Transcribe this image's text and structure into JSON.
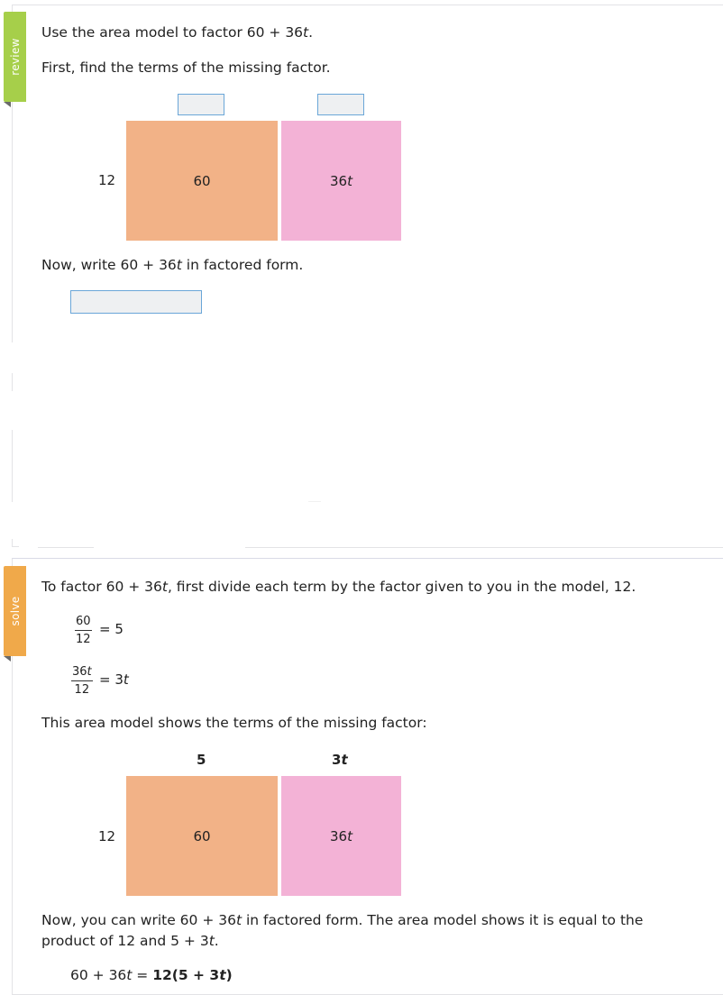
{
  "review": {
    "tab_label": "review",
    "prompt_prefix": "Use the area model to factor 60 + 36",
    "prompt_var": "t",
    "prompt_suffix": ".",
    "instruction": "First, find the terms of the missing factor.",
    "model": {
      "row_label": "12",
      "cell1": "60",
      "cell2_num": "36",
      "cell2_var": "t"
    },
    "write_prefix": "Now, write 60 + 36",
    "write_var": "t",
    "write_suffix": " in factored form."
  },
  "solve": {
    "tab_label": "solve",
    "intro_prefix": "To factor 60 + 36",
    "intro_var": "t",
    "intro_suffix": ", first divide each term by the factor given to you in the model, 12.",
    "frac1": {
      "num": "60",
      "den": "12",
      "result": "= 5"
    },
    "frac2": {
      "num": "36",
      "num_var": "t",
      "den": "12",
      "result_prefix": "= 3",
      "result_var": "t"
    },
    "model_caption": "This area model shows the terms of the missing factor:",
    "model": {
      "top1": "5",
      "top2_num": "3",
      "top2_var": "t",
      "row_label": "12",
      "cell1": "60",
      "cell2_num": "36",
      "cell2_var": "t"
    },
    "conclusion_line1_prefix": "Now, you can write 60 + 36",
    "conclusion_line1_var": "t",
    "conclusion_line1_suffix": " in factored form. The area model shows it is equal to the",
    "conclusion_line2_prefix": "product of 12 and 5 + 3",
    "conclusion_line2_var": "t",
    "conclusion_line2_suffix": ".",
    "answer_lhs_prefix": "60 + 36",
    "answer_lhs_var": "t",
    "answer_eq": " = ",
    "answer_rhs_prefix": "12(5 + 3",
    "answer_rhs_var": "t",
    "answer_rhs_suffix": ")"
  },
  "colors": {
    "review_tab": "#a6cf4a",
    "solve_tab": "#f0a94a",
    "cell_orange": "#f2b287",
    "cell_pink": "#f3b2d6",
    "input_border": "#6aa6d8",
    "input_fill": "#eef0f2"
  }
}
